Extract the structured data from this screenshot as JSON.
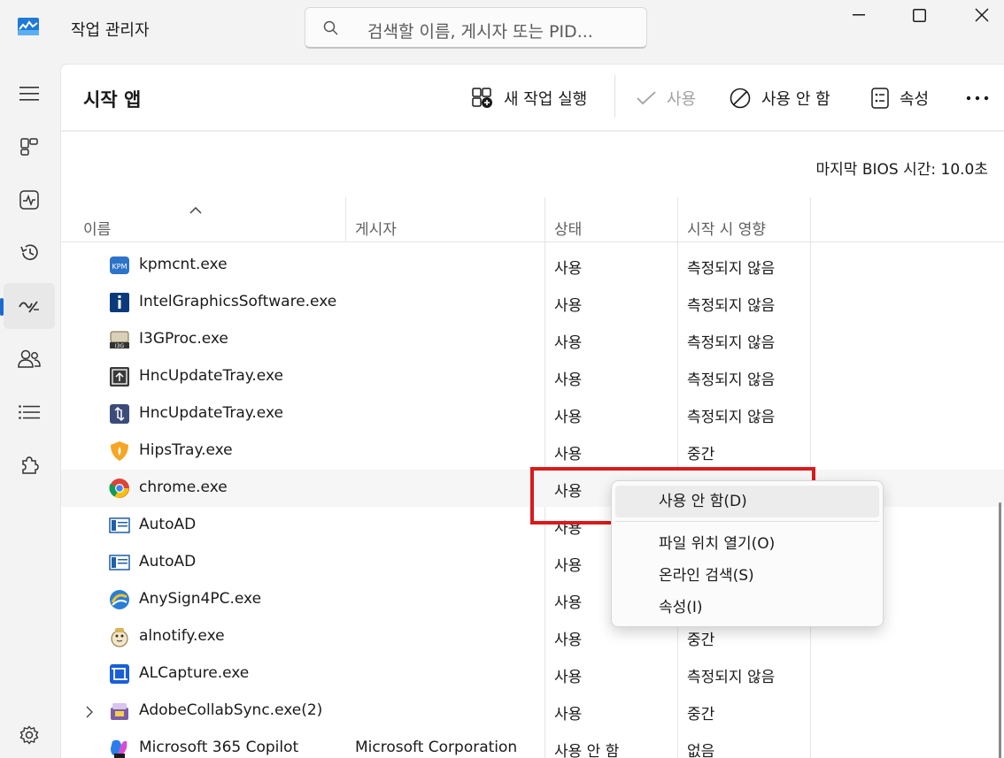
{
  "window": {
    "title": "작업 관리자",
    "search_placeholder": "검색할 이름, 게시자 또는 PID..."
  },
  "toolbar": {
    "page_title": "시작 앱",
    "new_task": "새 작업 실행",
    "enable": "사용",
    "disable": "사용 안 함",
    "properties": "속성"
  },
  "bios": {
    "label": "마지막 BIOS 시간:",
    "value": "10.0초"
  },
  "columns": {
    "name": "이름",
    "publisher": "게시자",
    "status": "상태",
    "impact": "시작 시 영향"
  },
  "rows": [
    {
      "name": "kpmcnt.exe",
      "publisher": "",
      "status": "사용",
      "impact": "측정되지 않음",
      "icon": "kpm-icon"
    },
    {
      "name": "IntelGraphicsSoftware.exe",
      "publisher": "",
      "status": "사용",
      "impact": "측정되지 않음",
      "icon": "intel-info-icon"
    },
    {
      "name": "I3GProc.exe",
      "publisher": "",
      "status": "사용",
      "impact": "측정되지 않음",
      "icon": "i3g-icon"
    },
    {
      "name": "HncUpdateTray.exe",
      "publisher": "",
      "status": "사용",
      "impact": "측정되지 않음",
      "icon": "hnc-update-icon"
    },
    {
      "name": "HncUpdateTray.exe",
      "publisher": "",
      "status": "사용",
      "impact": "측정되지 않음",
      "icon": "hnc-update-icon-2"
    },
    {
      "name": "HipsTray.exe",
      "publisher": "",
      "status": "사용",
      "impact": "중간",
      "icon": "hips-shield-icon"
    },
    {
      "name": "chrome.exe",
      "publisher": "",
      "status": "사용",
      "impact": "",
      "icon": "chrome-icon"
    },
    {
      "name": "AutoAD",
      "publisher": "",
      "status": "사용",
      "impact": "",
      "icon": "autoad-icon"
    },
    {
      "name": "AutoAD",
      "publisher": "",
      "status": "사용",
      "impact": "",
      "icon": "autoad-icon-2"
    },
    {
      "name": "AnySign4PC.exe",
      "publisher": "",
      "status": "사용",
      "impact": "",
      "icon": "anysign-icon"
    },
    {
      "name": "alnotify.exe",
      "publisher": "",
      "status": "사용",
      "impact": "중간",
      "icon": "alnotify-icon"
    },
    {
      "name": "ALCapture.exe",
      "publisher": "",
      "status": "사용",
      "impact": "측정되지 않음",
      "icon": "alcapture-icon"
    },
    {
      "name": "AdobeCollabSync.exe(2)",
      "publisher": "",
      "status": "사용",
      "impact": "중간",
      "icon": "adobe-collab-icon"
    },
    {
      "name": "Microsoft 365 Copilot",
      "publisher": "Microsoft Corporation",
      "status": "사용 안 함",
      "impact": "없음",
      "icon": "copilot-icon"
    }
  ],
  "context_menu": {
    "disable": "사용 안 함(D)",
    "open_location": "파일 위치 열기(O)",
    "search_online": "온라인 검색(S)",
    "properties": "속성(I)"
  },
  "colors": {
    "accent": "#1b6ad0",
    "highlight_box": "#d91b1b"
  }
}
